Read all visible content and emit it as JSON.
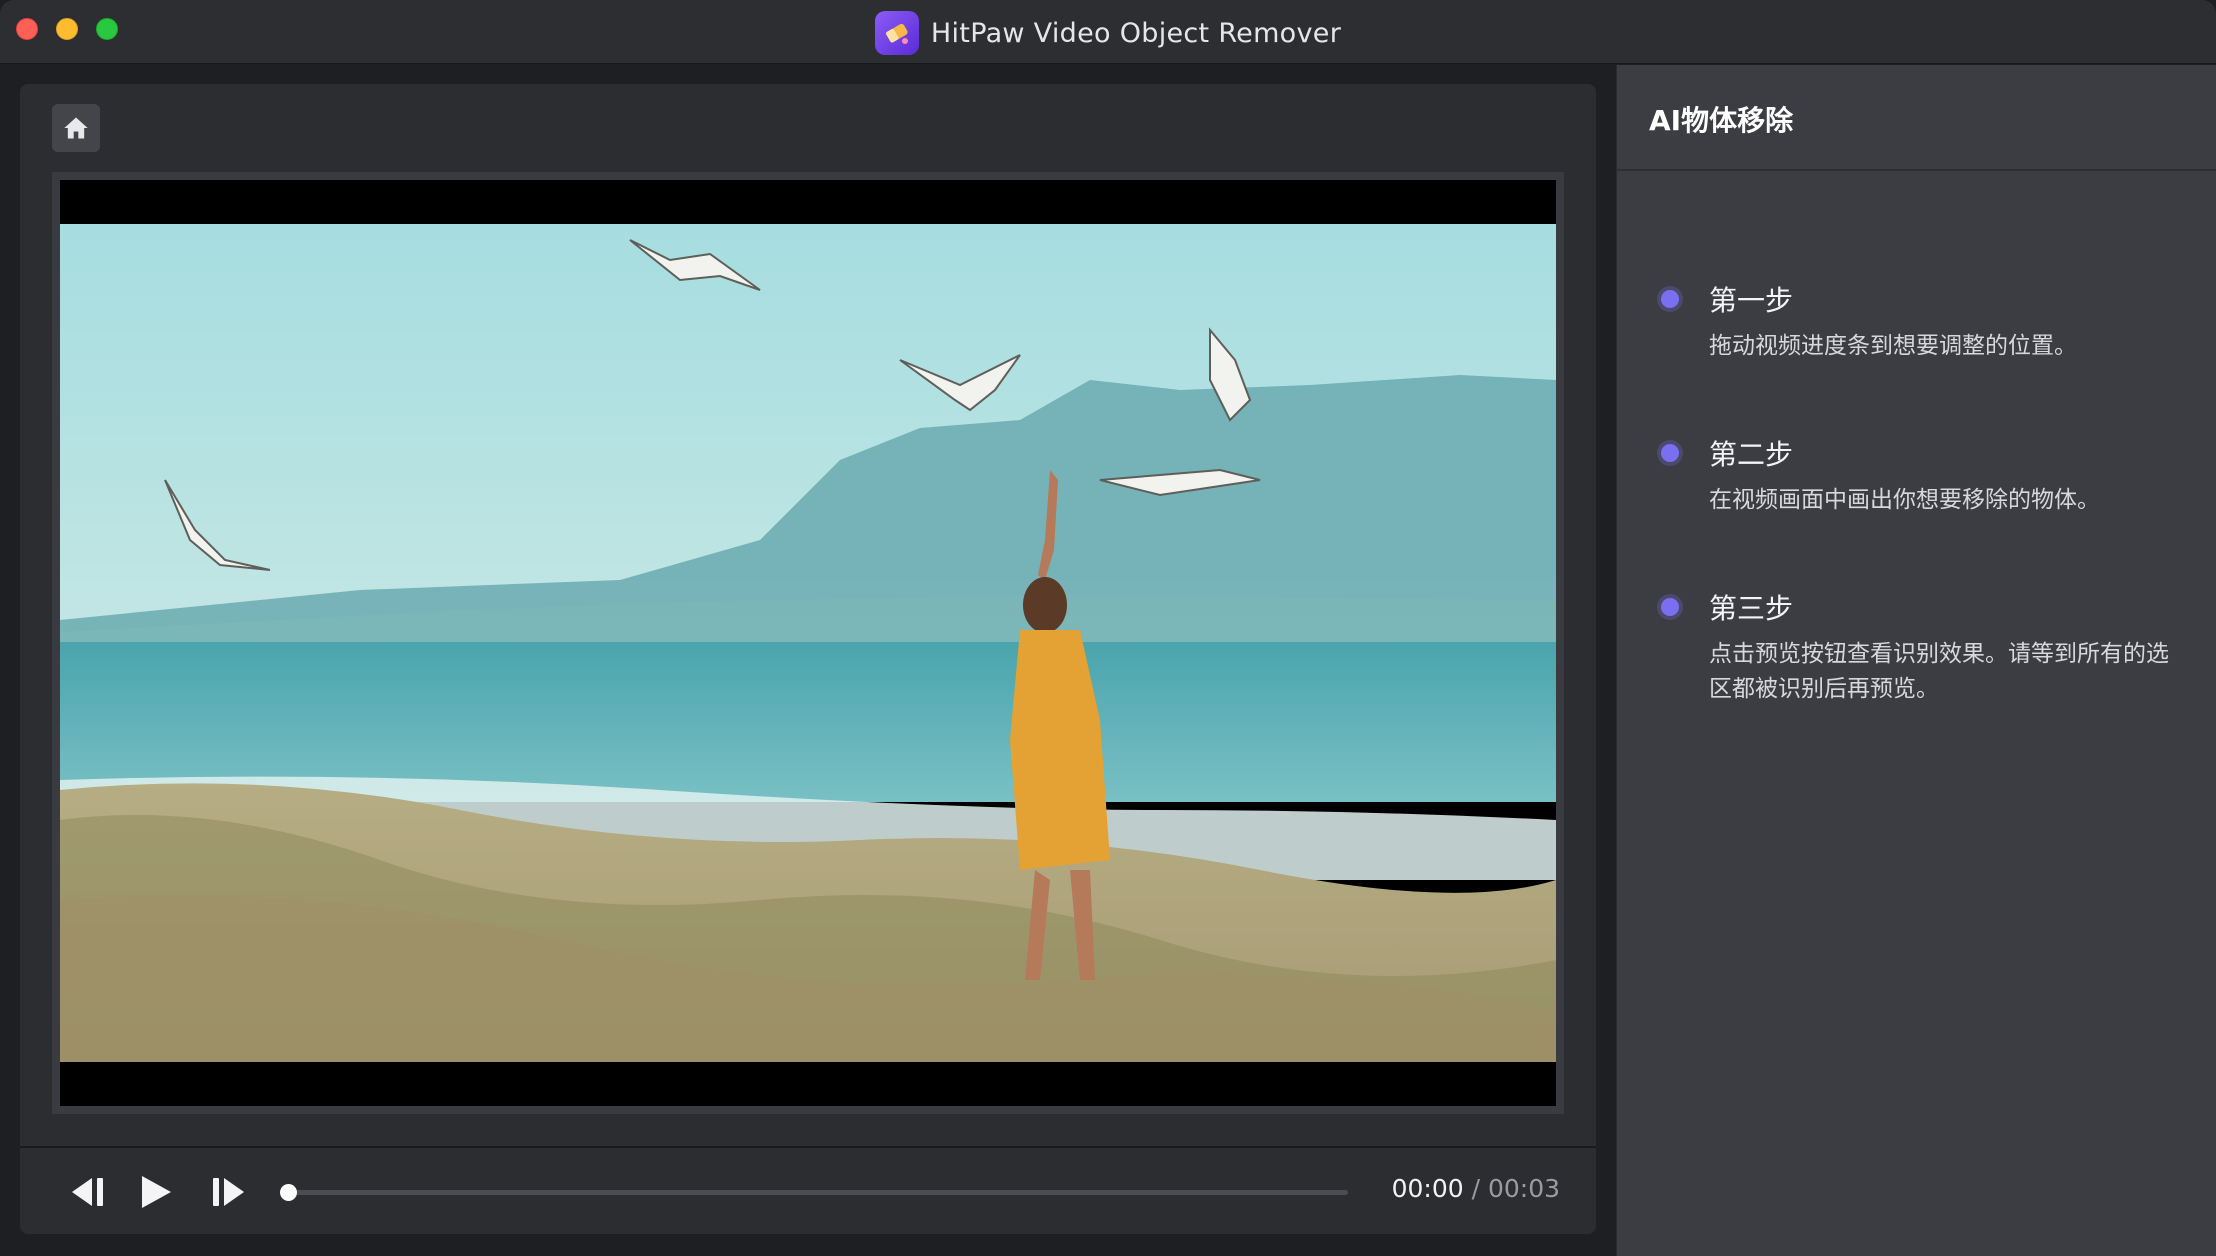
{
  "window": {
    "title": "HitPaw Video Object Remover",
    "app_icon": "hitpaw-eraser-icon"
  },
  "toolbar": {
    "home_icon": "home-icon"
  },
  "player": {
    "current_time": "00:00",
    "separator": " / ",
    "total_time": "00:03",
    "progress": 0.0,
    "prev_icon": "step-back-icon",
    "play_icon": "play-icon",
    "next_icon": "step-forward-icon"
  },
  "panel": {
    "title": "AI物体移除",
    "steps": [
      {
        "title": "第一步",
        "desc": "拖动视频进度条到想要调整的位置。"
      },
      {
        "title": "第二步",
        "desc": "在视频画面中画出你想要移除的物体。"
      },
      {
        "title": "第三步",
        "desc": "点击预览按钮查看识别效果。请等到所有的选区都被识别后再预览。"
      }
    ]
  },
  "colors": {
    "accent": "#7a6ff0",
    "panel_bg": "#3c3d42",
    "editor_bg": "#2c2d31"
  }
}
